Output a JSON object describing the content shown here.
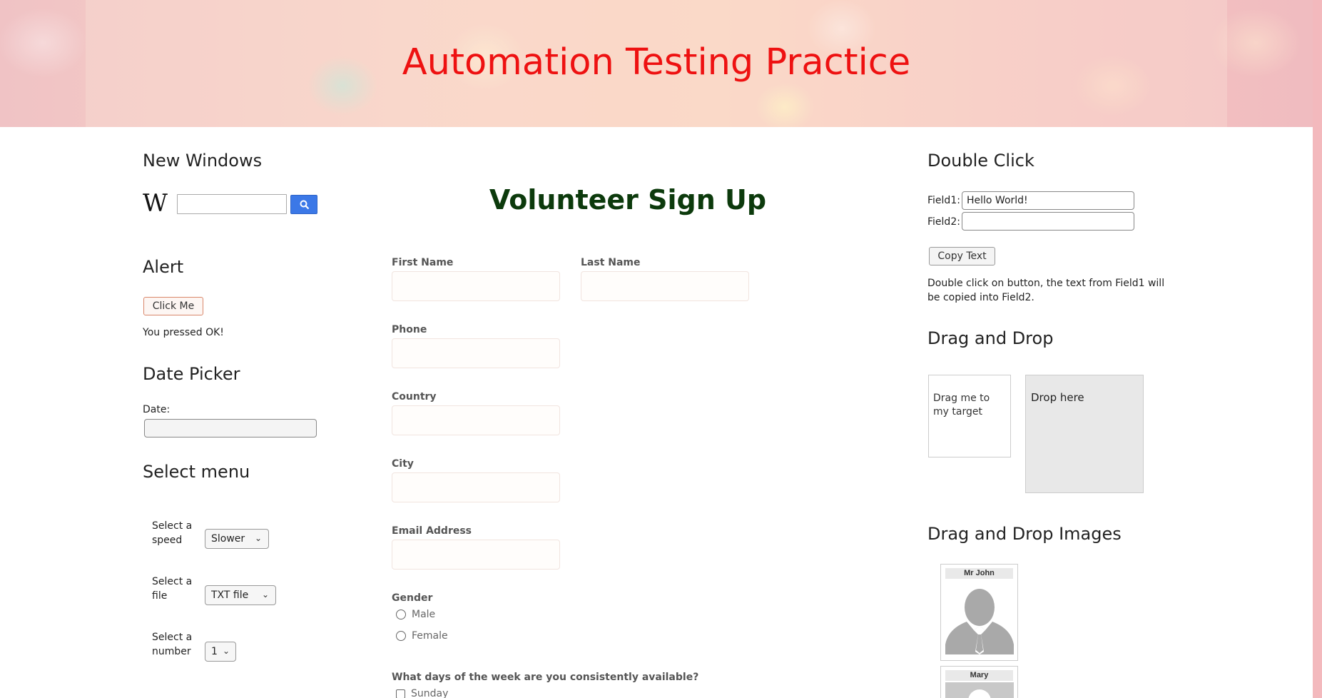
{
  "header": {
    "title": "Automation Testing Practice"
  },
  "new_windows": {
    "title": "New Windows",
    "search_input": {
      "value": "",
      "placeholder": ""
    }
  },
  "alert": {
    "title": "Alert",
    "button_label": "Click Me",
    "message": "You pressed OK!"
  },
  "date_picker": {
    "title": "Date Picker",
    "label": "Date:",
    "value": ""
  },
  "select_menu": {
    "title": "Select menu",
    "speed": {
      "label": "Select a speed",
      "selected": "Slower"
    },
    "file": {
      "label": "Select a file",
      "selected": "TXT file"
    },
    "number": {
      "label": "Select a number",
      "selected": "1"
    }
  },
  "form": {
    "title": "Volunteer Sign Up",
    "first_name": {
      "label": "First Name",
      "value": ""
    },
    "last_name": {
      "label": "Last Name",
      "value": ""
    },
    "phone": {
      "label": "Phone",
      "value": ""
    },
    "country": {
      "label": "Country",
      "value": ""
    },
    "city": {
      "label": "City",
      "value": ""
    },
    "email": {
      "label": "Email Address",
      "value": ""
    },
    "gender": {
      "label": "Gender",
      "options": [
        "Male",
        "Female"
      ]
    },
    "days": {
      "label": "What days of the week are you consistently available?",
      "options": [
        "Sunday"
      ]
    }
  },
  "double_click": {
    "title": "Double Click",
    "field1": {
      "label": "Field1:",
      "value": "Hello World!"
    },
    "field2": {
      "label": "Field2:",
      "value": ""
    },
    "button_label": "Copy Text",
    "description": "Double click on button, the text from Field1 will be copied into Field2."
  },
  "drag_drop": {
    "title": "Drag and Drop",
    "draggable_text": "Drag me to my target",
    "droppable_text": "Drop here"
  },
  "drag_drop_images": {
    "title": "Drag and Drop Images",
    "items": [
      {
        "caption": "Mr John"
      },
      {
        "caption": "Mary"
      }
    ]
  },
  "colors": {
    "header_title": "#ee1111",
    "form_title": "#0c3a0c",
    "search_button": "#3b78e7"
  }
}
